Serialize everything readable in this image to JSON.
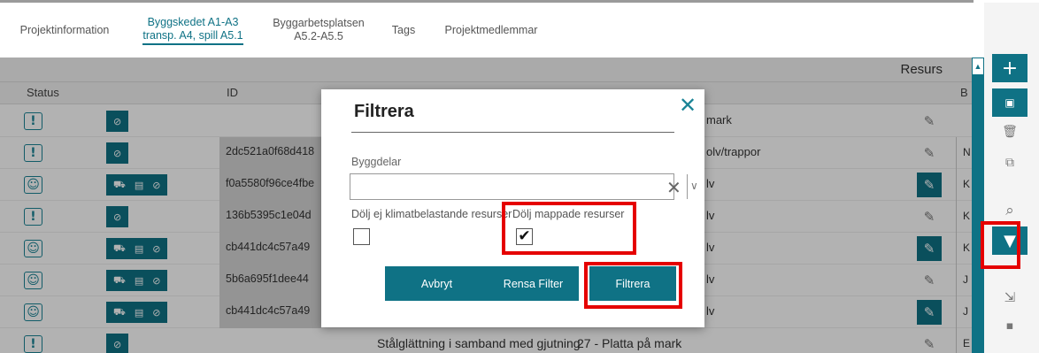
{
  "tabs": {
    "projektinfo": "Projektinformation",
    "byggskedet_l1": "Byggskedet A1-A3",
    "byggskedet_l2": "transp. A4, spill A5.1",
    "byggarbets_l1": "Byggarbetsplatsen",
    "byggarbets_l2": "A5.2-A5.5",
    "tags": "Tags",
    "projektmedlemmar": "Projektmedlemmar"
  },
  "grid": {
    "resurs_title": "Resurs",
    "headers": {
      "status": "Status",
      "id": "ID",
      "b": "B"
    },
    "rows": [
      {
        "status": "!",
        "actions": [
          "link"
        ],
        "id": "",
        "byggnadsdel": "mark",
        "pen_active": false,
        "b": ""
      },
      {
        "status": "!",
        "actions": [
          "link"
        ],
        "id": "2dc521a0f68d418",
        "byggnadsdel": "olv/trappor",
        "pen_active": false,
        "b": "N"
      },
      {
        "status": "smile",
        "actions": [
          "truck",
          "epd",
          "link"
        ],
        "id": "f0a5580f96ce4fbe",
        "byggnadsdel": "lv",
        "pen_active": true,
        "b": "K"
      },
      {
        "status": "!",
        "actions": [
          "link"
        ],
        "id": "136b5395c1e04d",
        "byggnadsdel": "lv",
        "pen_active": false,
        "b": "K"
      },
      {
        "status": "smile",
        "actions": [
          "truck",
          "epd",
          "link"
        ],
        "id": "cb441dc4c57a49",
        "byggnadsdel": "lv",
        "pen_active": true,
        "b": "K"
      },
      {
        "status": "smile",
        "actions": [
          "truck",
          "epd",
          "link"
        ],
        "id": "5b6a695f1dee44",
        "byggnadsdel": "lv",
        "pen_active": false,
        "b": "J"
      },
      {
        "status": "smile",
        "actions": [
          "truck",
          "epd",
          "link"
        ],
        "id": "cb441dc4c57a49",
        "byggnadsdel": "lv",
        "pen_active": true,
        "b": "J"
      },
      {
        "status": "!",
        "actions": [
          "link"
        ],
        "id": "",
        "beskrivning": "Stålglättning i samband med gjutning",
        "byggnadsdel": "27 - Platta på mark",
        "pen_active": false,
        "b": "E"
      }
    ]
  },
  "sidebar": {
    "icons": [
      "plus-icon",
      "folder-plus-icon",
      "trash-icon",
      "copy-icon",
      "search-icon",
      "filter-icon",
      "export-icon",
      "folder-icon"
    ]
  },
  "modal": {
    "title": "Filtrera",
    "field_label": "Byggdelar",
    "field_value": "",
    "checkbox1_label": "Dölj ej klimatbelastande resurser",
    "checkbox1_checked": false,
    "checkbox2_label": "Dölj mappade resurser",
    "checkbox2_checked": true,
    "btn_cancel": "Avbryt",
    "btn_clear": "Rensa Filter",
    "btn_filter": "Filtrera"
  },
  "colors": {
    "teal": "#0f7285",
    "highlight": "#e50000"
  }
}
